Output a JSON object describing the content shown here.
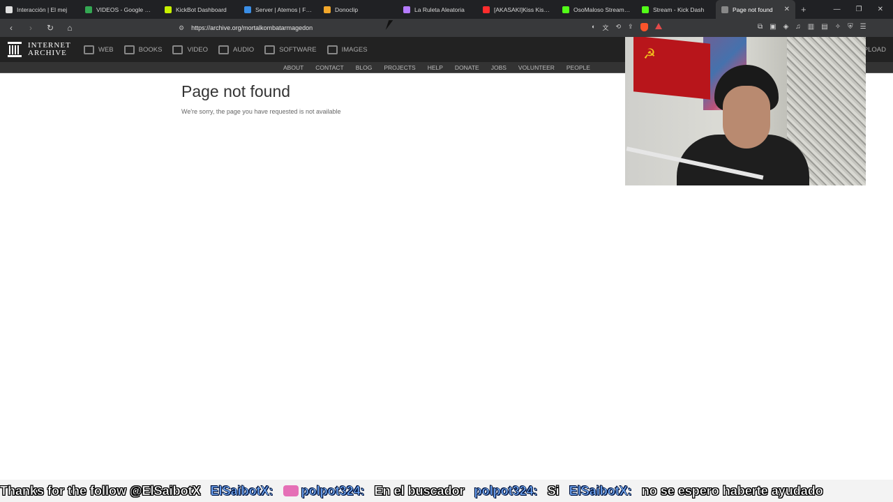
{
  "browser": {
    "tabs": [
      {
        "label": "Interacción | El mej",
        "color": "#e0e0e0"
      },
      {
        "label": "VIDEOS - Google Drive",
        "color": "#34a853"
      },
      {
        "label": "KickBot Dashboard",
        "color": "#c7f000"
      },
      {
        "label": "Server | Atemos | Free",
        "color": "#3a8ee6"
      },
      {
        "label": "Donoclip",
        "color": "#f2a72b"
      },
      {
        "label": "La Ruleta Aleatoria",
        "color": "#b57bff"
      },
      {
        "label": "[AKASAKI]Kiss Kiss Kis",
        "color": "#ff2d2d"
      },
      {
        "label": "OsoMaloso Stream - V",
        "color": "#53fc18"
      },
      {
        "label": "Stream - Kick Dash",
        "color": "#53fc18"
      },
      {
        "label": "Page not found",
        "color": "#888888"
      }
    ],
    "active_tab_close": "✕",
    "new_tab": "+",
    "url": "https://archive.org/mortalkombatarmagedon"
  },
  "ia_header": {
    "logo_line1": "INTERNET",
    "logo_line2": "ARCHIVE",
    "media": [
      "WEB",
      "BOOKS",
      "VIDEO",
      "AUDIO",
      "SOFTWARE",
      "IMAGES"
    ],
    "upload": "PLOAD",
    "sub_links": [
      "ABOUT",
      "CONTACT",
      "BLOG",
      "PROJECTS",
      "HELP",
      "DONATE",
      "JOBS",
      "VOLUNTEER",
      "PEOPLE"
    ]
  },
  "page": {
    "title": "Page not found",
    "message": "We're sorry, the page you have requested is not available"
  },
  "ticker": {
    "follow_msg": "Thanks for the follow @ElSaibotX",
    "user1": "ElSaibotX",
    "user2": "polpot324",
    "msg2": "En el buscador",
    "user3": "polpot324",
    "msg3": "Si",
    "user4": "ElSaibotX",
    "msg4": "no se espero haberte ayudado"
  }
}
